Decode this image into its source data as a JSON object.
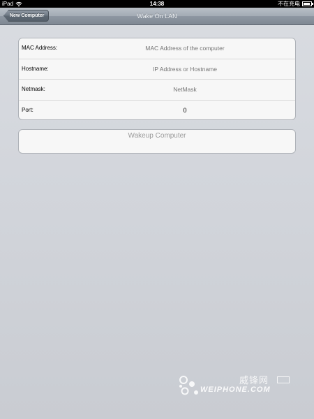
{
  "status_bar": {
    "device": "iPad",
    "time": "14:38",
    "charge_status": "不在充电",
    "icons": [
      "wifi-icon",
      "battery-icon"
    ]
  },
  "nav": {
    "back_label": "New Computer",
    "title": "Wake On LAN"
  },
  "form": {
    "rows": [
      {
        "label": "MAC Address:",
        "placeholder": "MAC Address of the computer",
        "value": ""
      },
      {
        "label": "Hostname:",
        "placeholder": "IP Address or Hostname",
        "value": ""
      },
      {
        "label": "Netmask:",
        "placeholder": "NetMask",
        "value": ""
      },
      {
        "label": "Port:",
        "placeholder": "",
        "value": "0"
      }
    ]
  },
  "actions": {
    "wakeup_label": "Wakeup Computer"
  },
  "watermark": {
    "cn_text": "威锋网",
    "en_text": "WEIPHONE.COM"
  },
  "colors": {
    "background": "#d3d6dc",
    "nav_bar": "#a3abb5",
    "placeholder_text": "#b3b3b3",
    "button_text": "#9a9a9a"
  }
}
